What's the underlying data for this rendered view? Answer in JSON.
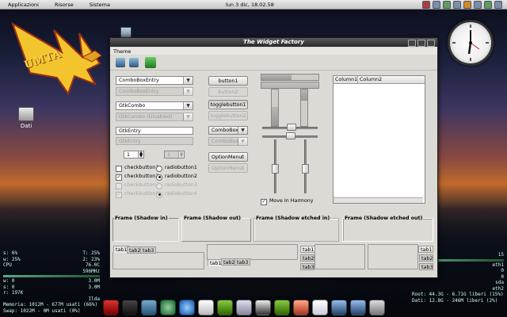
{
  "top_panel": {
    "menus": [
      "Applicazioni",
      "Risorse",
      "Sistema"
    ],
    "clock": "lun  3 dic, 18.02.58"
  },
  "desktop": {
    "logo_text": "UMTA",
    "icon_label": "Dati"
  },
  "window": {
    "title": "The Widget Factory",
    "menu": "Theme",
    "combo_entry": "ComboBoxEntry",
    "combo_entry_disabled": "ComboBoxEntry",
    "gtk_combo": "GtkCombo",
    "gtk_combo_disabled": "GtkCombo (Disabled)",
    "gtk_entry": "GtkEntry",
    "gtk_entry_disabled": "GtkEntry",
    "spin1": "1",
    "spin2": "1",
    "checks": [
      {
        "label": "checkbutton1",
        "checked": false,
        "disabled": false
      },
      {
        "label": "checkbutton2",
        "checked": true,
        "disabled": false
      },
      {
        "label": "checkbutton3",
        "checked": false,
        "disabled": true
      },
      {
        "label": "checkbutton4",
        "checked": true,
        "disabled": true
      }
    ],
    "radios": [
      {
        "label": "radiobutton1",
        "on": false,
        "disabled": false
      },
      {
        "label": "radiobutton2",
        "on": true,
        "disabled": false
      },
      {
        "label": "radiobutton3",
        "on": false,
        "disabled": true
      },
      {
        "label": "radiobutton4",
        "on": true,
        "disabled": true
      }
    ],
    "button1": "button1",
    "button2": "button2",
    "togglebutton1": "togglebutton1",
    "togglebutton2": "togglebutton2",
    "combobox": "ComboBox",
    "combobox_disabled": "ComboBox",
    "optionmenu": "OptionMenu",
    "optionmenu_disabled": "OptionMenu",
    "move_in_harmony": "Move In Harmony",
    "treeview_columns": [
      "Column1",
      "Column2"
    ],
    "frames": [
      "Frame (Shadow in)",
      "Frame (Shadow out)",
      "Frame (Shadow etched in)",
      "Frame (Shadow etched out)"
    ],
    "tabs": [
      "tab1",
      "tab2",
      "tab3"
    ]
  },
  "conky_left": {
    "lines": [
      [
        "s: 6%",
        "T: 25%"
      ],
      [
        "w: 25%",
        "2: 23%"
      ],
      [
        "CPU",
        "76.0C"
      ],
      [
        "",
        "596MHz"
      ],
      [
        "w: 0",
        "3.0M"
      ],
      [
        "s: 0",
        "3.0M"
      ],
      [
        "r: 197K",
        ""
      ],
      [
        "",
        "Ilda"
      ]
    ],
    "memory": "Memoria: 1012M - 677M usati (66%)",
    "swap": "Swap: 1022M - 0M usati (0%)"
  },
  "conky_right": {
    "lines": [
      [
        "",
        "15"
      ],
      [
        "",
        "eth1"
      ],
      [
        "",
        "0"
      ],
      [
        "",
        "0"
      ],
      [
        "",
        "sda"
      ],
      [
        "",
        "eth2"
      ]
    ],
    "root": "Root:  44.3G - 6.71G liberi (15%)",
    "dati": "Dati:  12.8G - 246M liberi (2%)"
  },
  "colors": {
    "accent_green": "#3a9a3a",
    "accent_blue": "#3a6fc0"
  }
}
